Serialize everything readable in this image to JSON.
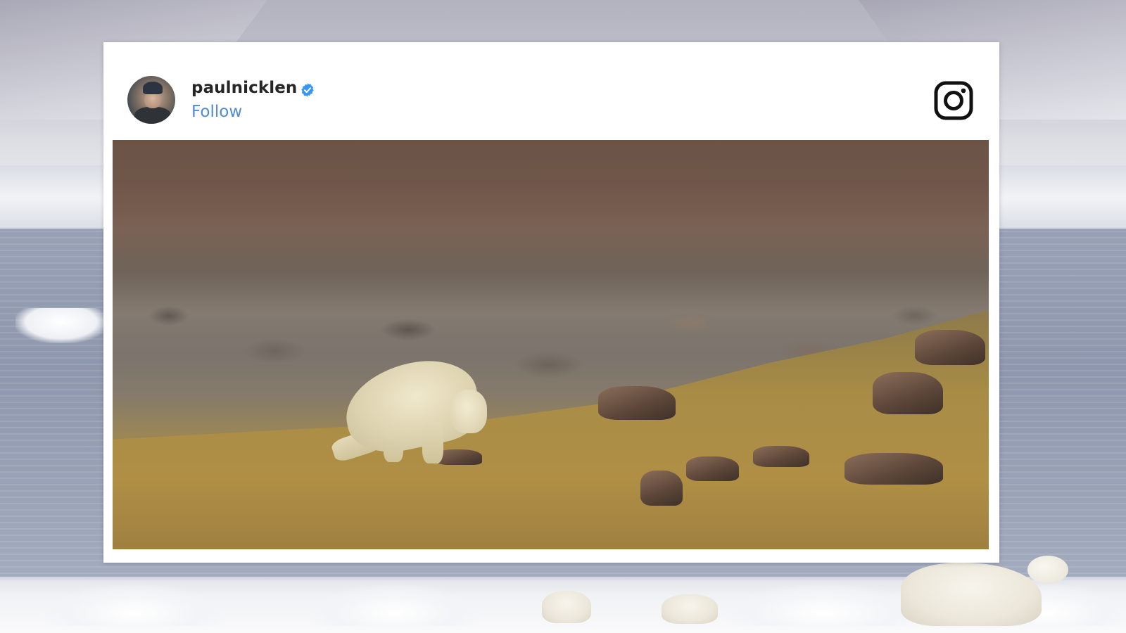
{
  "post": {
    "username": "paulnicklen",
    "follow_label": "Follow"
  },
  "icons": {
    "verified": "verified-badge-icon",
    "logo": "instagram-logo-icon"
  },
  "colors": {
    "follow_link": "#4f8bd1",
    "verified_badge": "#3897f0",
    "username_text": "#262626",
    "card_background": "#ffffff"
  }
}
